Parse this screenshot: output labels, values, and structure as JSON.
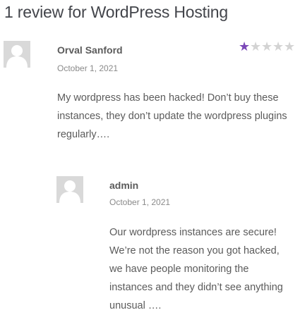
{
  "reviews_title": "1 review for WordPress Hosting",
  "review": {
    "author": "Orval Sanford",
    "date": "October 1, 2021",
    "text": "My wordpress has been hacked! Don’t buy these instances, they don’t update the wordpress plugins regularly….",
    "rating": 1,
    "rating_max": 5,
    "star_color": "#7b48b8",
    "avatar_icon": "default-avatar-icon"
  },
  "reply": {
    "author": "admin",
    "date": "October 1, 2021",
    "text": "Our wordpress instances are secure! We’re not the reason you got hacked, we have people monitoring the instances and they didn’t see anything unusual ….",
    "avatar_icon": "default-avatar-icon"
  }
}
